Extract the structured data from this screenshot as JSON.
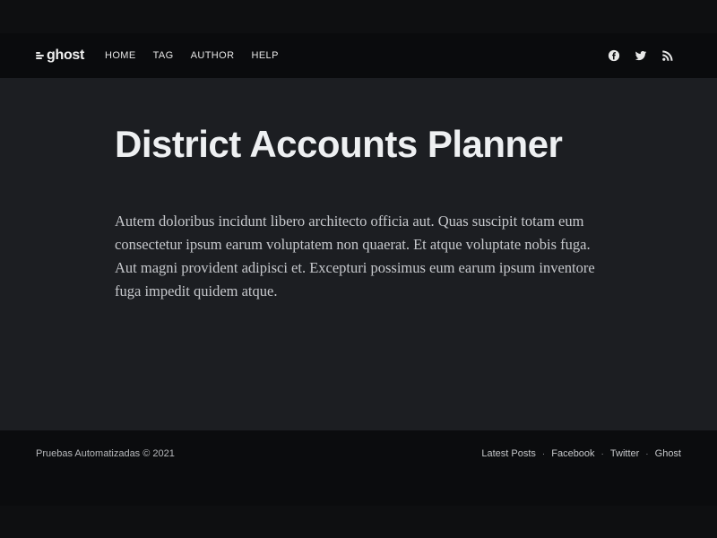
{
  "header": {
    "logo_text": "ghost",
    "nav": [
      {
        "label": "HOME"
      },
      {
        "label": "TAG"
      },
      {
        "label": "AUTHOR"
      },
      {
        "label": "HELP"
      }
    ],
    "social_icons": [
      "facebook-icon",
      "twitter-icon",
      "rss-icon"
    ]
  },
  "post": {
    "title": "District Accounts Planner",
    "body": "Autem doloribus incidunt libero architecto officia aut. Quas suscipit totam eum consectetur ipsum earum voluptatem non quaerat. Et atque voluptate nobis fuga. Aut magni provident adipisci et. Excepturi possimus eum earum ipsum inventore fuga impedit quidem atque."
  },
  "footer": {
    "copyright": "Pruebas Automatizadas © 2021",
    "links": [
      {
        "label": "Latest Posts"
      },
      {
        "label": "Facebook"
      },
      {
        "label": "Twitter"
      },
      {
        "label": "Ghost"
      }
    ],
    "separator": "·"
  },
  "colors": {
    "header_bg": "#0a0b0d",
    "main_bg": "#1c1e22",
    "footer_bg": "#0b0c0e",
    "title_text": "#eef0f2",
    "body_text": "#c6c8cc"
  }
}
